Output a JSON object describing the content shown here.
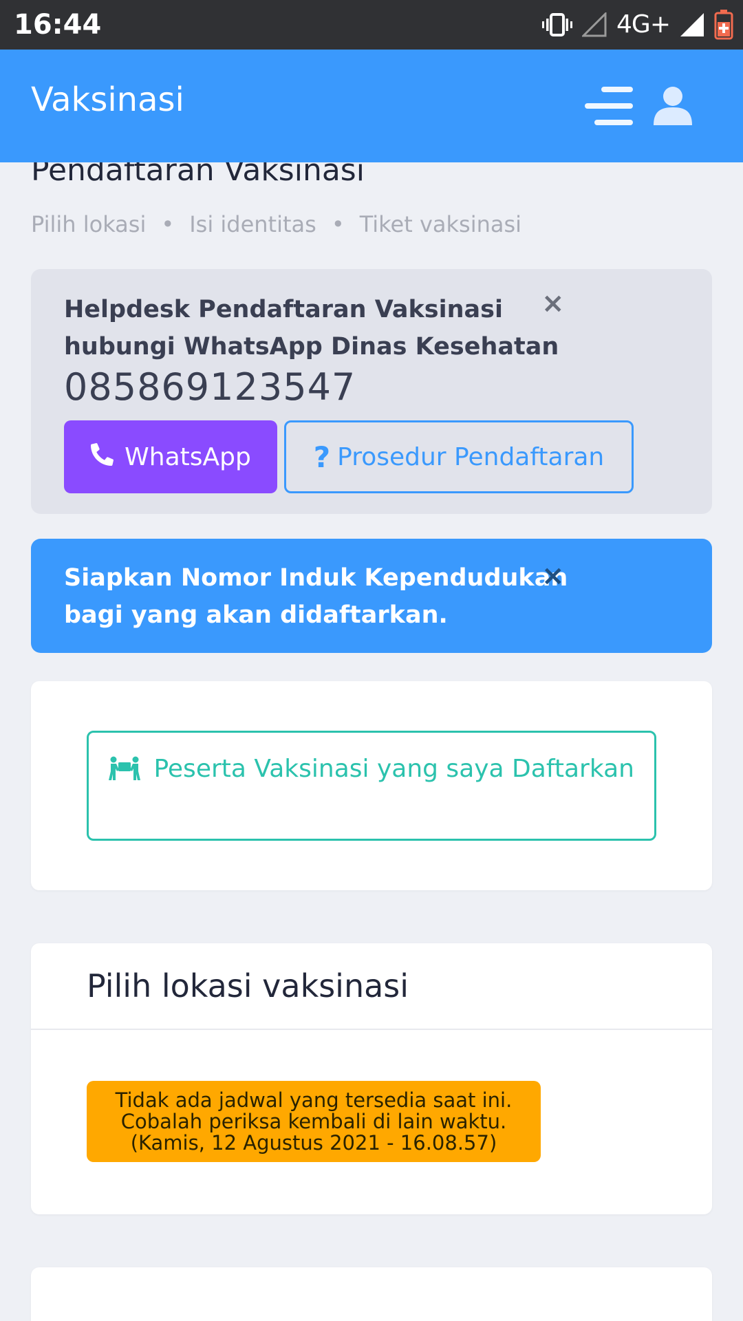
{
  "status_bar": {
    "time": "16:44",
    "network": "4G+",
    "icons": [
      "vibrate-icon",
      "signal-empty-icon",
      "signal-full-icon",
      "battery-icon"
    ]
  },
  "app_bar": {
    "title": "Vaksinasi",
    "icons": [
      "menu-icon",
      "user-icon"
    ]
  },
  "page": {
    "title": "Pendaftaran Vaksinasi",
    "breadcrumb": [
      "Pilih lokasi",
      "Isi identitas",
      "Tiket vaksinasi"
    ],
    "breadcrumb_separator": "•"
  },
  "helpdesk_alert": {
    "message": "Helpdesk Pendaftaran Vaksinasi hubungi WhatsApp Dinas Kesehatan",
    "phone": "085869123547",
    "close_label": "×",
    "whatsapp_button": "WhatsApp",
    "procedure_button": "Prosedur Pendaftaran",
    "procedure_icon": "?"
  },
  "info_alert": {
    "message": "Siapkan Nomor Induk Kependudukan bagi yang akan didaftarkan.",
    "close_label": "×"
  },
  "participants_card": {
    "button_label": "Peserta Vaksinasi yang saya Daftarkan",
    "icon": "people-carry-icon"
  },
  "location_card": {
    "title": "Pilih lokasi vaksinasi",
    "notice_lines": [
      "Tidak ada jadwal yang tersedia saat ini.",
      "Cobalah periksa kembali di lain waktu.",
      "(Kamis, 12 Agustus 2021 - 16.08.57)"
    ]
  },
  "colors": {
    "primary": "#3a99fd",
    "whatsapp_button": "#8a4bff",
    "teal": "#2bc2ad",
    "warning": "#ffa800",
    "status_bar": "#303134",
    "background": "#eef0f5"
  }
}
